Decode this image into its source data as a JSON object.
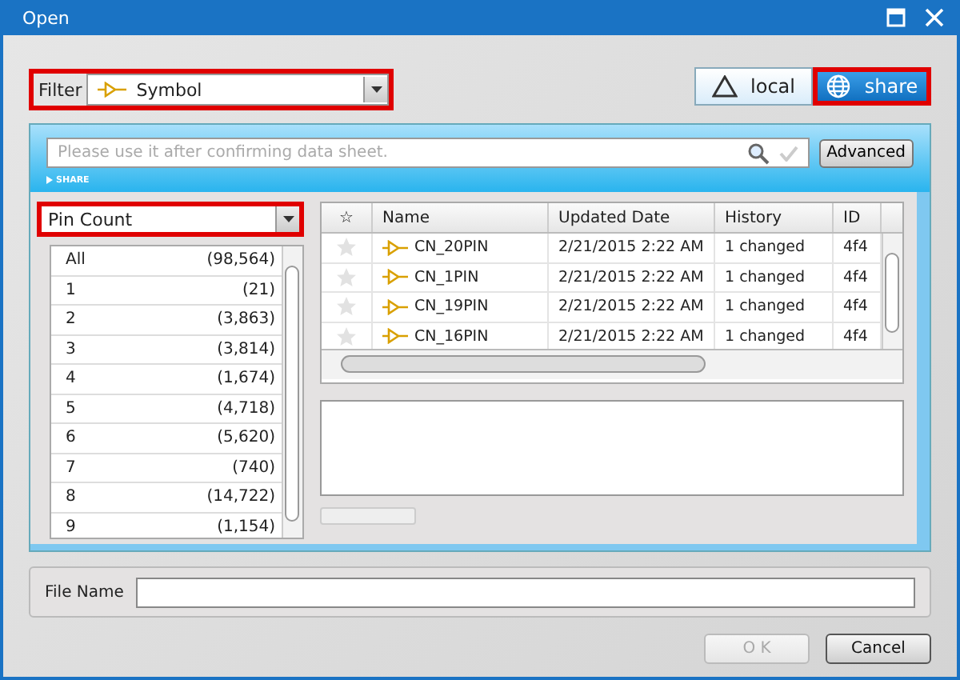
{
  "window": {
    "title": "Open"
  },
  "filter": {
    "label": "Filter",
    "value": "Symbol",
    "highlighted": true
  },
  "sources": [
    {
      "label": "local",
      "kind": "local",
      "selected": false,
      "highlighted": false
    },
    {
      "label": "share",
      "kind": "shared",
      "selected": true,
      "highlighted": true
    }
  ],
  "search": {
    "placeholder": "Please use it after confirming data sheet.",
    "advanced_button": "Advanced",
    "section_label": "SHARE"
  },
  "facet": {
    "value": "Pin Count",
    "highlighted": true,
    "items": [
      {
        "label": "All",
        "count": "(98,564)"
      },
      {
        "label": "1",
        "count": "(21)"
      },
      {
        "label": "2",
        "count": "(3,863)"
      },
      {
        "label": "3",
        "count": "(3,814)"
      },
      {
        "label": "4",
        "count": "(1,674)"
      },
      {
        "label": "5",
        "count": "(4,718)"
      },
      {
        "label": "6",
        "count": "(5,620)"
      },
      {
        "label": "7",
        "count": "(740)"
      },
      {
        "label": "8",
        "count": "(14,722)"
      },
      {
        "label": "9",
        "count": "(1,154)"
      }
    ]
  },
  "table": {
    "star_column": "☆",
    "columns": [
      "Name",
      "Updated Date",
      "History",
      "ID"
    ],
    "rows": [
      {
        "favorite": false,
        "name": "CN_20PIN",
        "updated": "2/21/2015 2:22 AM",
        "history": "1 changed",
        "id": "4f4"
      },
      {
        "favorite": false,
        "name": "CN_1PIN",
        "updated": "2/21/2015 2:22 AM",
        "history": "1 changed",
        "id": "4f4"
      },
      {
        "favorite": false,
        "name": "CN_19PIN",
        "updated": "2/21/2015 2:22 AM",
        "history": "1 changed",
        "id": "4f4"
      },
      {
        "favorite": false,
        "name": "CN_16PIN",
        "updated": "2/21/2015 2:22 AM",
        "history": "1 changed",
        "id": "4f4"
      }
    ]
  },
  "file_name": {
    "label": "File Name"
  },
  "buttons": [
    {
      "label": "O K",
      "disabled": true
    },
    {
      "label": "Cancel",
      "disabled": false
    }
  ]
}
